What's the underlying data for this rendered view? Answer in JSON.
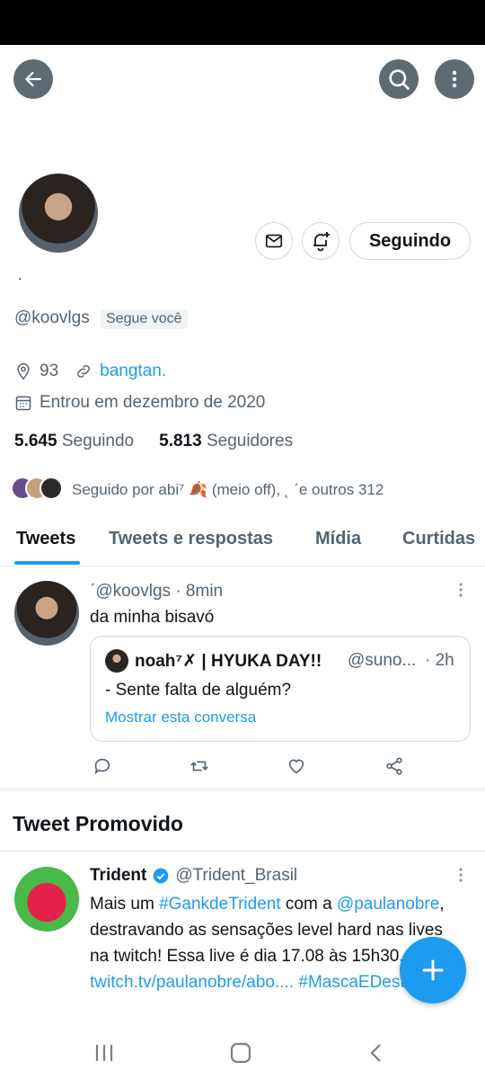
{
  "profile": {
    "name_dot": ".",
    "handle": "@koovlgs",
    "follows_you": "Segue você",
    "location": "93",
    "website": "bangtan.",
    "joined": "Entrou em dezembro de 2020",
    "following_count": "5.645",
    "following_label": "Seguindo",
    "followers_count": "5.813",
    "followers_label": "Seguidores",
    "followed_by": "Seguido por abi⁷ 🍂 (meio off), ˛ ˊe outros 312",
    "follow_button": "Seguindo"
  },
  "tabs": [
    "Tweets",
    "Tweets e respostas",
    "Mídia",
    "Curtidas"
  ],
  "tweet": {
    "author_line": "ˊ@koovlgs · 8min",
    "text": "da minha bisavó",
    "quote": {
      "name": "noah⁷✗ | HYUKA DAY!!",
      "handle": "@suno...",
      "time": "· 2h",
      "text": "- Sente falta de alguém?",
      "show_thread": "Mostrar esta conversa"
    }
  },
  "promoted": {
    "section_title": "Tweet Promovido",
    "name": "Trident",
    "handle": "@Trident_Brasil",
    "body_parts": [
      {
        "t": "Mais um ",
        "link": false
      },
      {
        "t": "#GankdeTrident",
        "link": true
      },
      {
        "t": " com a ",
        "link": false
      },
      {
        "t": "@paulanobre",
        "link": true
      },
      {
        "t": ", destravando as sensações level hard nas lives na twitch! Essa live é dia 17.08 às 15h30, na ",
        "link": false
      },
      {
        "t": "twitch.tv/paulanobre/abo....",
        "link": true
      },
      {
        "t": " ",
        "link": false
      },
      {
        "t": "#MascaEDestrava",
        "link": true
      }
    ]
  },
  "colors": {
    "accent": "#1d9bf0",
    "muted": "#536471",
    "text": "#0f1419"
  }
}
